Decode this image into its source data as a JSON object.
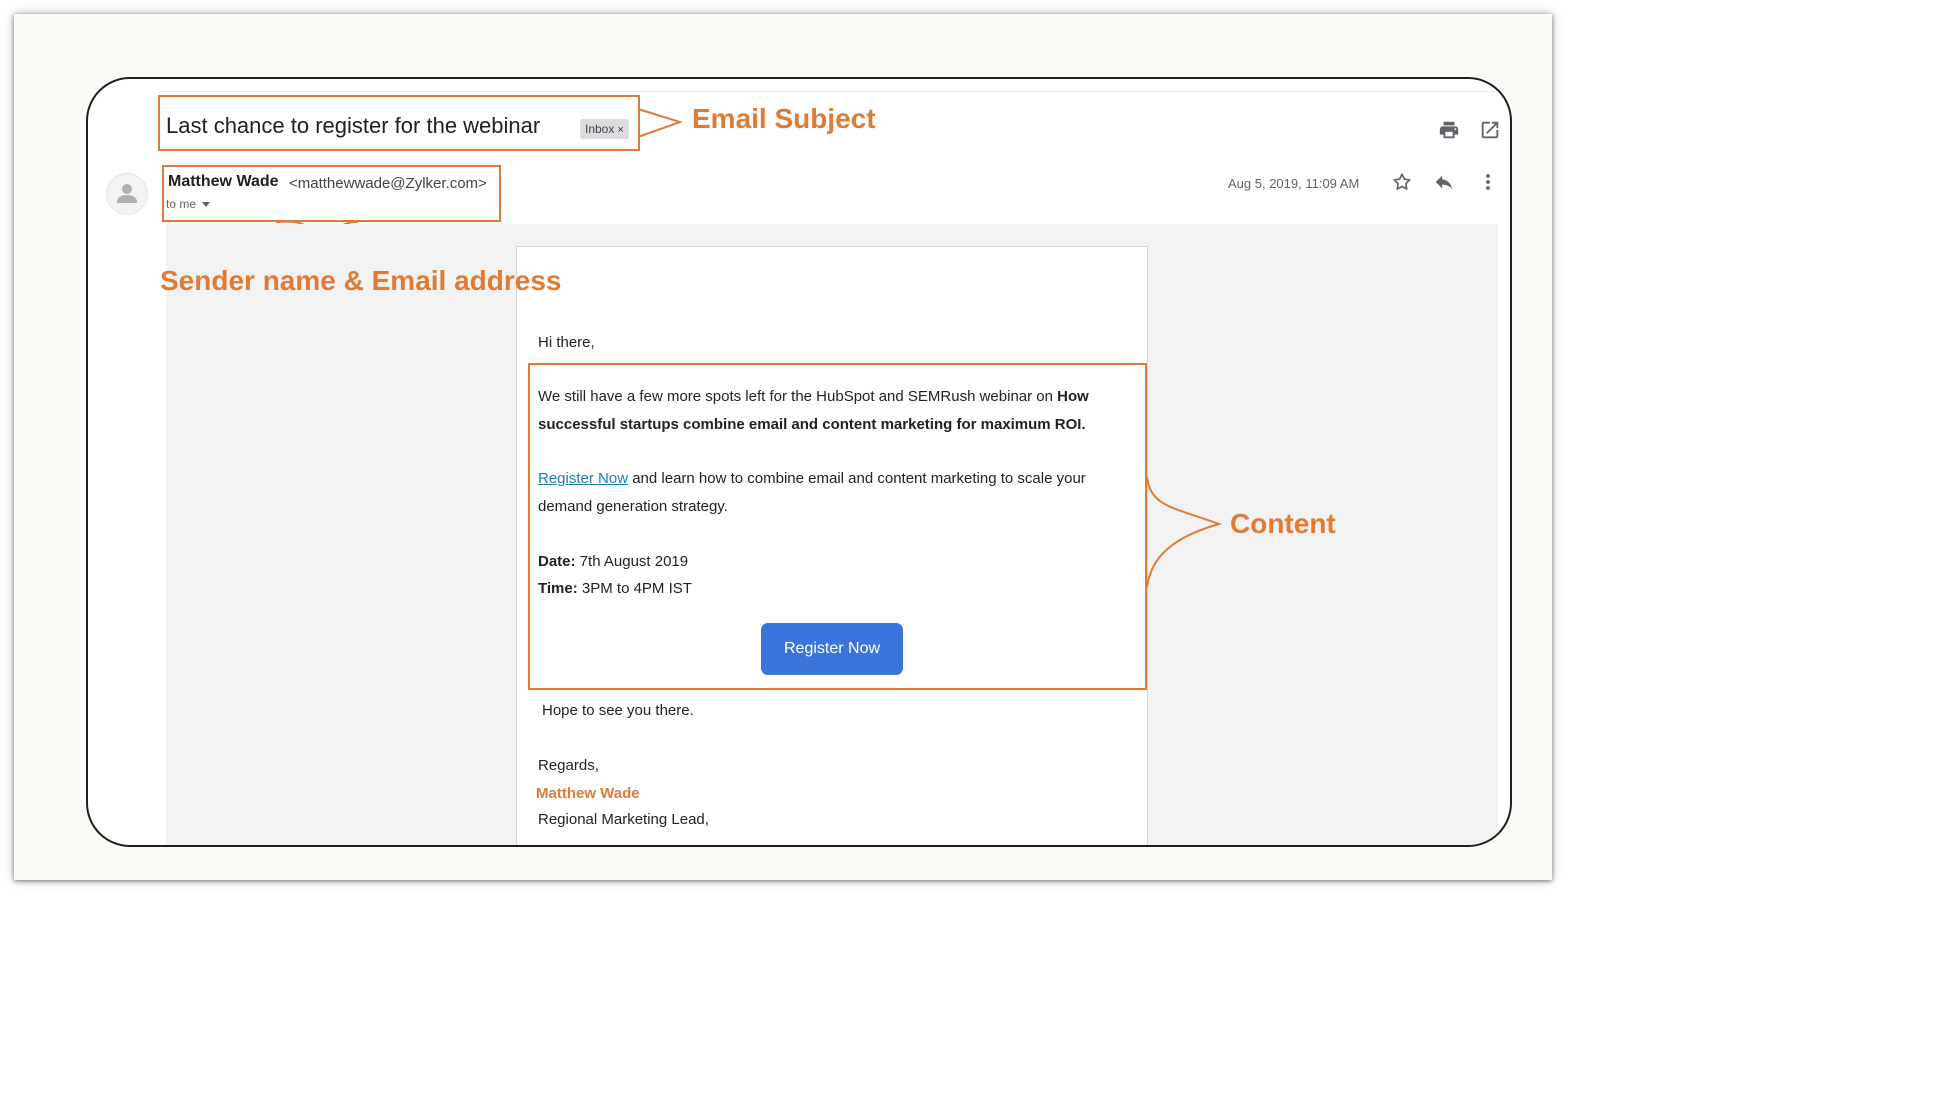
{
  "email": {
    "subject": "Last chance to register for the webinar",
    "label_chip": "Inbox",
    "label_chip_close": "×",
    "sender_name": "Matthew Wade",
    "sender_email": "<matthewwade@Zylker.com>",
    "recipient": "to me",
    "date": "Aug 5, 2019, 11:09 AM"
  },
  "annotations": {
    "subject": "Email Subject",
    "sender": "Sender name & Email address",
    "content": "Content"
  },
  "body": {
    "greeting": "Hi there,",
    "intro_plain": "We still have a few more spots left  for the HubSpot and SEMRush webinar on ",
    "intro_bold_1": "How",
    "intro_bold_2": "successful startups combine email and content marketing for maximum ROI.",
    "register_link": "Register Now",
    "register_text_1": " and learn how to combine email and content marketing to scale your",
    "register_text_2": "demand generation strategy.",
    "date_label": "Date:",
    "date_value": " 7th August 2019",
    "time_label": "Time:",
    "time_value": " 3PM to 4PM IST",
    "register_button": "Register Now",
    "closing": "Hope to see you there.",
    "regards": "Regards,",
    "signature_name": "Matthew Wade",
    "signature_title": "Regional Marketing Lead,"
  },
  "icons": [
    "print-icon",
    "open-in-new-window-icon",
    "avatar-icon",
    "dropdown-caret-icon",
    "star-icon",
    "reply-icon",
    "more-vert-icon"
  ],
  "colors": {
    "annotation": "#e07b35",
    "button": "#3b75dc",
    "link": "#1a7fb3",
    "chip": "#dadce0",
    "content_background": "#f2f2f2"
  }
}
